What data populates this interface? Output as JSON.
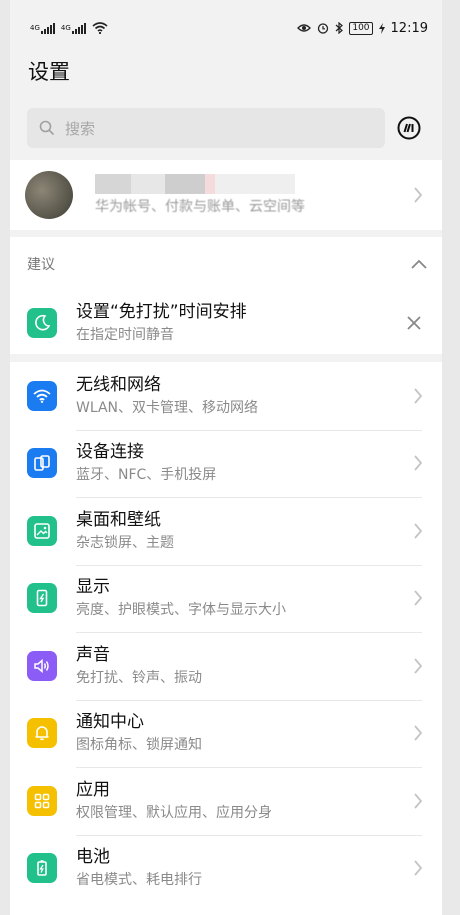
{
  "status_bar": {
    "network_1": "4G",
    "network_2": "4G",
    "battery": "100",
    "time": "12:19"
  },
  "page": {
    "title": "设置"
  },
  "search": {
    "placeholder": "搜索"
  },
  "account": {
    "subtitle": "华为帐号、付款与账单、云空间等"
  },
  "suggestion": {
    "header": "建议",
    "item": {
      "title": "设置“免打扰”时间安排",
      "subtitle": "在指定时间静音",
      "icon": "moon-icon",
      "color": "#22c08a"
    }
  },
  "menu": [
    {
      "label": "无线和网络",
      "subtitle": "WLAN、双卡管理、移动网络",
      "icon": "wifi-icon",
      "color": "#1a7cf0"
    },
    {
      "label": "设备连接",
      "subtitle": "蓝牙、NFC、手机投屏",
      "icon": "device-connect-icon",
      "color": "#1a7cf0"
    },
    {
      "label": "桌面和壁纸",
      "subtitle": "杂志锁屏、主题",
      "icon": "wallpaper-icon",
      "color": "#22c08a"
    },
    {
      "label": "显示",
      "subtitle": "亮度、护眼模式、字体与显示大小",
      "icon": "display-icon",
      "color": "#22c08a"
    },
    {
      "label": "声音",
      "subtitle": "免打扰、铃声、振动",
      "icon": "sound-icon",
      "color": "#8b5cf6"
    },
    {
      "label": "通知中心",
      "subtitle": "图标角标、锁屏通知",
      "icon": "bell-icon",
      "color": "#f5c000"
    },
    {
      "label": "应用",
      "subtitle": "权限管理、默认应用、应用分身",
      "icon": "apps-icon",
      "color": "#f5c000"
    },
    {
      "label": "电池",
      "subtitle": "省电模式、耗电排行",
      "icon": "battery-icon",
      "color": "#22c08a"
    }
  ]
}
